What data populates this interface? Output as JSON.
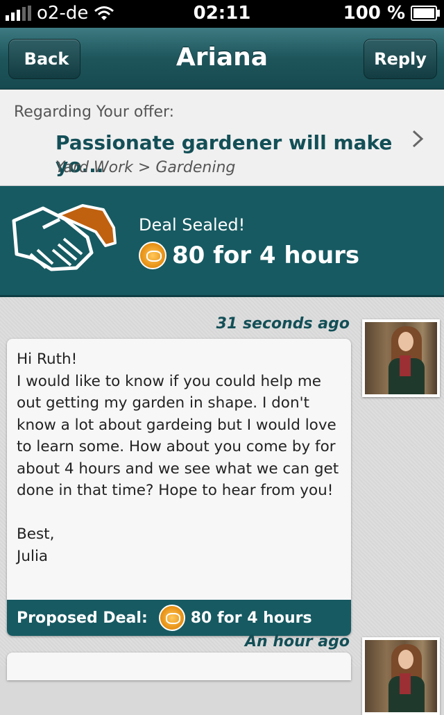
{
  "status_bar": {
    "carrier": "o2-de",
    "time": "02:11",
    "battery": "100 %"
  },
  "nav": {
    "back_label": "Back",
    "title": "Ariana",
    "reply_label": "Reply"
  },
  "regarding": {
    "label": "Regarding Your offer:",
    "title": "Passionate gardener will make yo...",
    "category": "Yard Work > Gardening"
  },
  "deal": {
    "status": "Deal Sealed!",
    "value": "80 for 4 hours"
  },
  "messages": [
    {
      "timestamp": "31 seconds ago",
      "body": "Hi Ruth!\nI would like to know if you could help me out getting my garden in shape. I don't know a lot about gardeing but I would love to learn some. How about you come by for about 4 hours and we see what we can get done in that time? Hope to hear from you!\n\nBest,\nJulia",
      "footer_label": "Proposed Deal:",
      "footer_value": "80 for 4 hours"
    },
    {
      "timestamp": "An hour ago"
    }
  ],
  "colors": {
    "accent": "#175a62",
    "title_text": "#134f57",
    "coin": "#e58d10"
  }
}
